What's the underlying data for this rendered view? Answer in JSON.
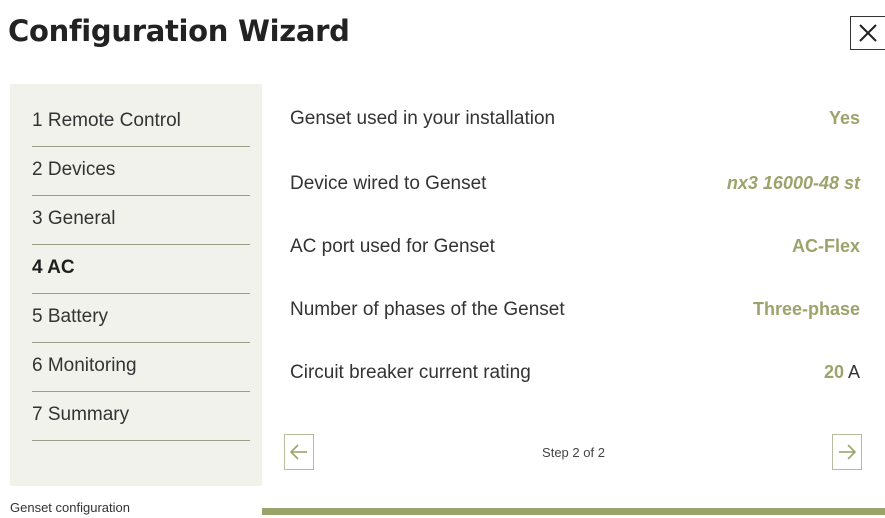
{
  "window": {
    "title": "Configuration Wizard"
  },
  "icons": {
    "close": "close-icon",
    "prev": "arrow-left-icon",
    "next": "arrow-right-icon"
  },
  "colors": {
    "accent": "#9da36b",
    "sidebar_bg": "#f2f2ed",
    "progress": "#9aa36a"
  },
  "sidebar": {
    "items": [
      {
        "label": "1 Remote Control",
        "active": false
      },
      {
        "label": "2 Devices",
        "active": false
      },
      {
        "label": "3 General",
        "active": false
      },
      {
        "label": "4 AC",
        "active": true
      },
      {
        "label": "5 Battery",
        "active": false
      },
      {
        "label": "6 Monitoring",
        "active": false
      },
      {
        "label": "7 Summary",
        "active": false
      }
    ]
  },
  "settings": {
    "genset_used": {
      "label": "Genset used in your installation",
      "value": "Yes"
    },
    "device_wired": {
      "label": "Device wired to Genset",
      "value": "nx3 16000-48 st"
    },
    "ac_port": {
      "label": "AC port used for Genset",
      "value": "AC-Flex"
    },
    "phases": {
      "label": "Number of phases of the Genset",
      "value": "Three-phase"
    },
    "breaker": {
      "label": "Circuit breaker current rating",
      "value": "20",
      "unit": "A"
    }
  },
  "pager": {
    "step_text": "Step 2 of 2"
  },
  "footer": {
    "section_label": "Genset configuration"
  },
  "progress": {
    "fraction": 1.0
  }
}
